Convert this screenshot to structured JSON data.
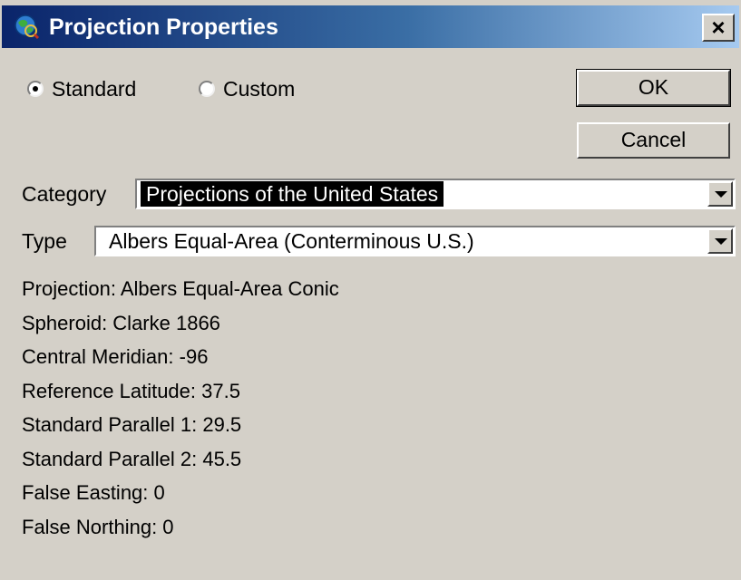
{
  "window": {
    "title": "Projection Properties",
    "close_label": "×",
    "icon": "globe-icon"
  },
  "mode": {
    "options": [
      {
        "label": "Standard",
        "selected": true
      },
      {
        "label": "Custom",
        "selected": false
      }
    ]
  },
  "buttons": {
    "ok_label": "OK",
    "cancel_label": "Cancel"
  },
  "category": {
    "label": "Category",
    "value": "Projections of the United States"
  },
  "type": {
    "label": "Type",
    "value": "Albers Equal-Area (Conterminous U.S.)"
  },
  "properties": [
    "Projection: Albers Equal-Area Conic",
    "Spheroid: Clarke 1866",
    "Central Meridian: -96",
    "Reference Latitude: 37.5",
    "Standard Parallel 1: 29.5",
    "Standard Parallel 2: 45.5",
    "False Easting: 0",
    "False Northing: 0"
  ],
  "colors": {
    "titlebar_start": "#0a246a",
    "titlebar_end": "#a6caf0",
    "face": "#d4d0c8"
  }
}
